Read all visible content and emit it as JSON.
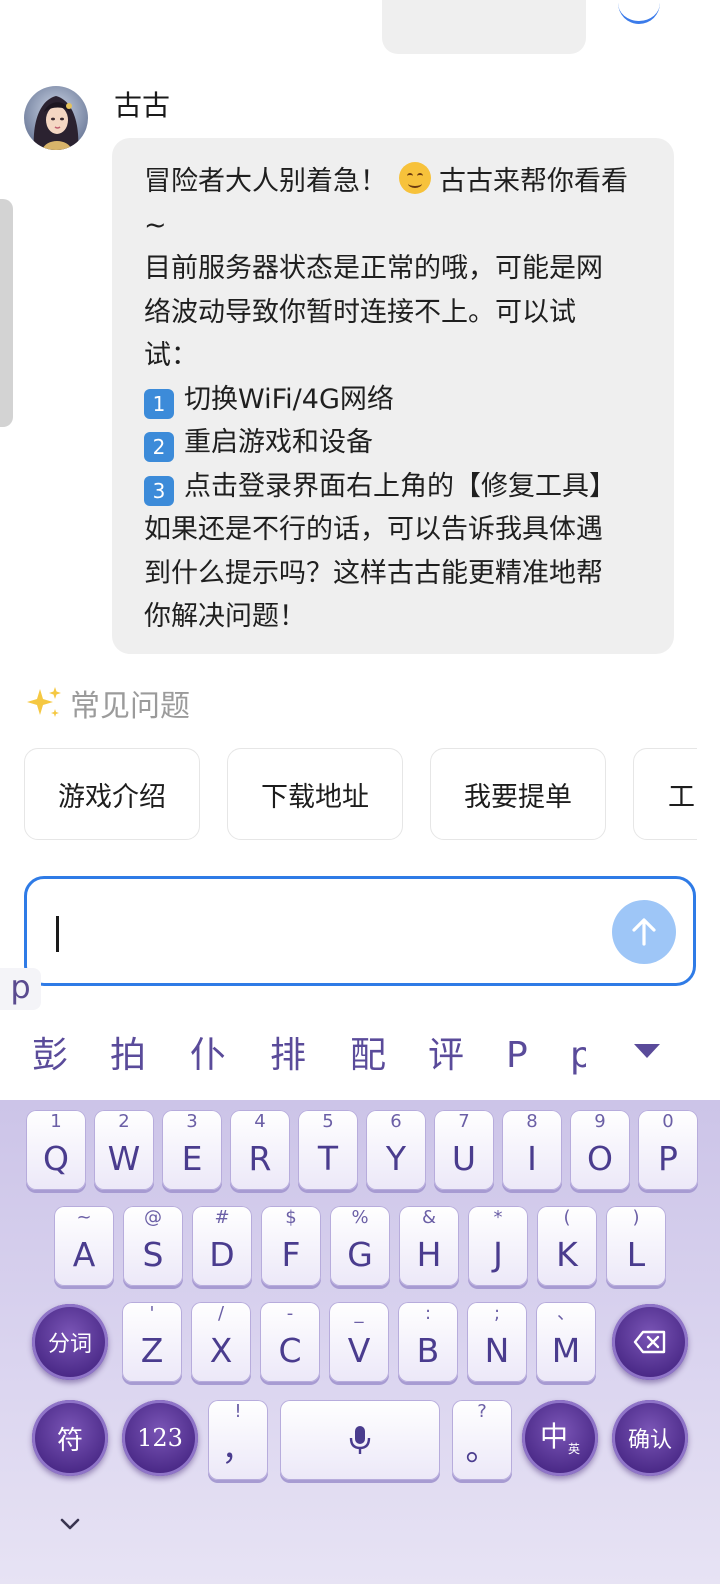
{
  "chat": {
    "sender_name": "古古",
    "lines": [
      {
        "text_before": "冒险者大人别着急！",
        "emoji": "smiling-face",
        "text_after": "古古来帮你看看"
      },
      {
        "text": "~"
      },
      {
        "text": "目前服务器状态是正常的哦，可能是网"
      },
      {
        "text": "络波动导致你暂时连接不上。可以试"
      },
      {
        "text": "试："
      },
      {
        "num": "1",
        "text": "切换WiFi/4G网络"
      },
      {
        "num": "2",
        "text": "重启游戏和设备"
      },
      {
        "num": "3",
        "text": "点击登录界面右上角的【修复工具】"
      },
      {
        "text": "如果还是不行的话，可以告诉我具体遇"
      },
      {
        "text": "到什么提示吗？这样古古能更精准地帮"
      },
      {
        "text": "你解决问题！"
      }
    ]
  },
  "faq": {
    "icon": "sparkles-icon",
    "title": "常见问题",
    "chips": [
      "游戏介绍",
      "下载地址",
      "我要提单",
      "工…"
    ]
  },
  "input": {
    "value": "",
    "send_icon": "arrow-up-icon",
    "composing_text": "p"
  },
  "ime": {
    "candidates": [
      "彭",
      "拍",
      "仆",
      "排",
      "配",
      "评",
      "P",
      "p"
    ],
    "expand_icon": "triangle-down-icon",
    "row1": [
      {
        "hint": "1",
        "key": "Q"
      },
      {
        "hint": "2",
        "key": "W"
      },
      {
        "hint": "3",
        "key": "E"
      },
      {
        "hint": "4",
        "key": "R"
      },
      {
        "hint": "5",
        "key": "T"
      },
      {
        "hint": "6",
        "key": "Y"
      },
      {
        "hint": "7",
        "key": "U"
      },
      {
        "hint": "8",
        "key": "I"
      },
      {
        "hint": "9",
        "key": "O"
      },
      {
        "hint": "0",
        "key": "P"
      }
    ],
    "row2": [
      {
        "hint": "~",
        "key": "A"
      },
      {
        "hint": "@",
        "key": "S"
      },
      {
        "hint": "#",
        "key": "D"
      },
      {
        "hint": "$",
        "key": "F"
      },
      {
        "hint": "%",
        "key": "G"
      },
      {
        "hint": "&",
        "key": "H"
      },
      {
        "hint": "*",
        "key": "J"
      },
      {
        "hint": "(",
        "key": "K"
      },
      {
        "hint": ")",
        "key": "L"
      }
    ],
    "row3": [
      {
        "hint": "'",
        "key": "Z"
      },
      {
        "hint": "/",
        "key": "X"
      },
      {
        "hint": "-",
        "key": "C"
      },
      {
        "hint": "_",
        "key": "V"
      },
      {
        "hint": ":",
        "key": "B"
      },
      {
        "hint": ";",
        "key": "N"
      },
      {
        "hint": "、",
        "key": "M"
      }
    ],
    "segment_label": "分词",
    "backspace_icon": "backspace-icon",
    "symbol_label": "符",
    "numeric_label": "123",
    "comma": {
      "hint": "!",
      "key": "，"
    },
    "mic_icon": "microphone-icon",
    "period": {
      "hint": "?",
      "key": "。"
    },
    "lang": {
      "main": "中",
      "sub": "英"
    },
    "confirm_label": "确认",
    "hide_icon": "chevron-down-icon",
    "theme_color": "#4b2a88"
  }
}
